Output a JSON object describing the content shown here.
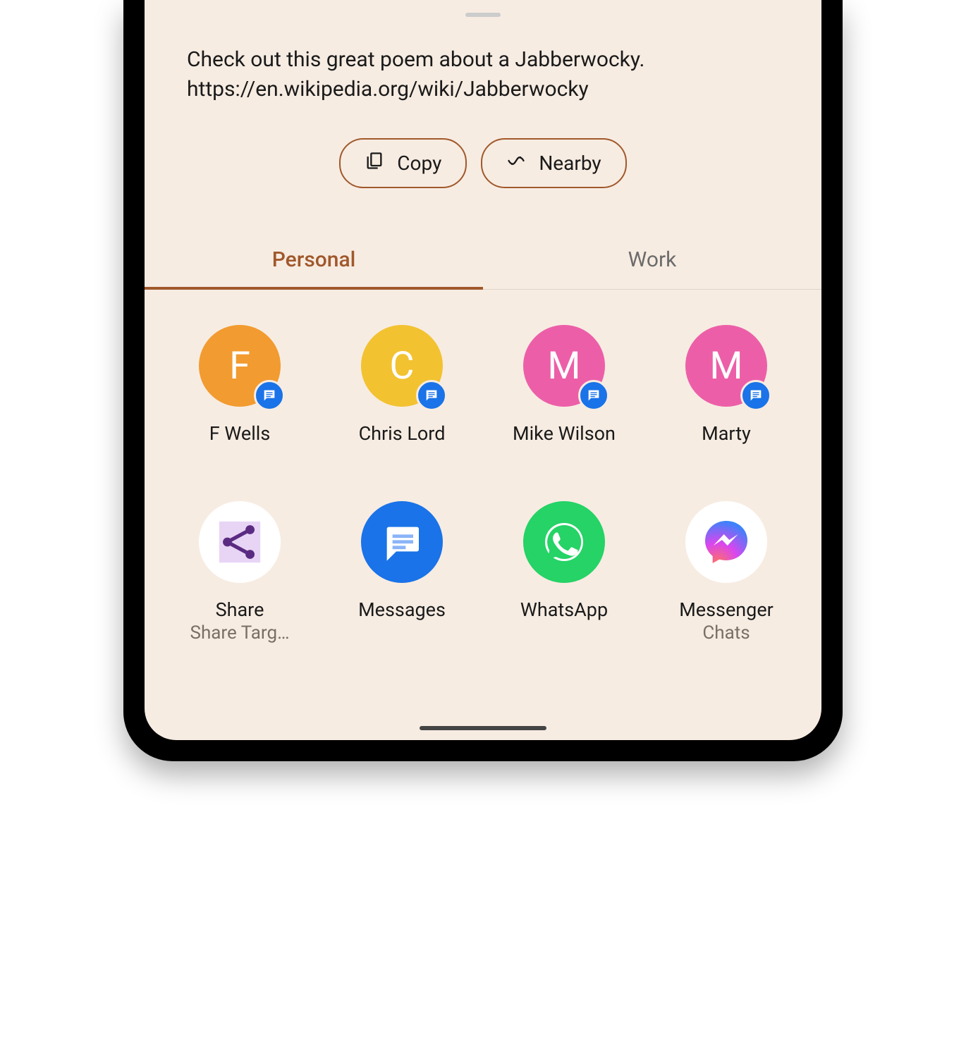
{
  "share_text_line1": "Check out this great poem about a Jabberwocky.",
  "share_text_line2": "https://en.wikipedia.org/wiki/Jabberwocky",
  "actions": {
    "copy_label": "Copy",
    "nearby_label": "Nearby"
  },
  "tabs": {
    "personal_label": "Personal",
    "work_label": "Work",
    "active": "personal"
  },
  "contacts": [
    {
      "initial": "F",
      "name": "F Wells",
      "color": "#f29b30"
    },
    {
      "initial": "C",
      "name": "Chris Lord",
      "color": "#f2c230"
    },
    {
      "initial": "M",
      "name": "Mike Wilson",
      "color": "#ec5fa8"
    },
    {
      "initial": "M",
      "name": "Marty",
      "color": "#ec5fa8"
    }
  ],
  "apps": [
    {
      "name": "Share",
      "sub": "Share Targ…",
      "icon": "share"
    },
    {
      "name": "Messages",
      "sub": "",
      "icon": "messages"
    },
    {
      "name": "WhatsApp",
      "sub": "",
      "icon": "whatsapp"
    },
    {
      "name": "Messenger",
      "sub": "Chats",
      "icon": "messenger"
    }
  ]
}
